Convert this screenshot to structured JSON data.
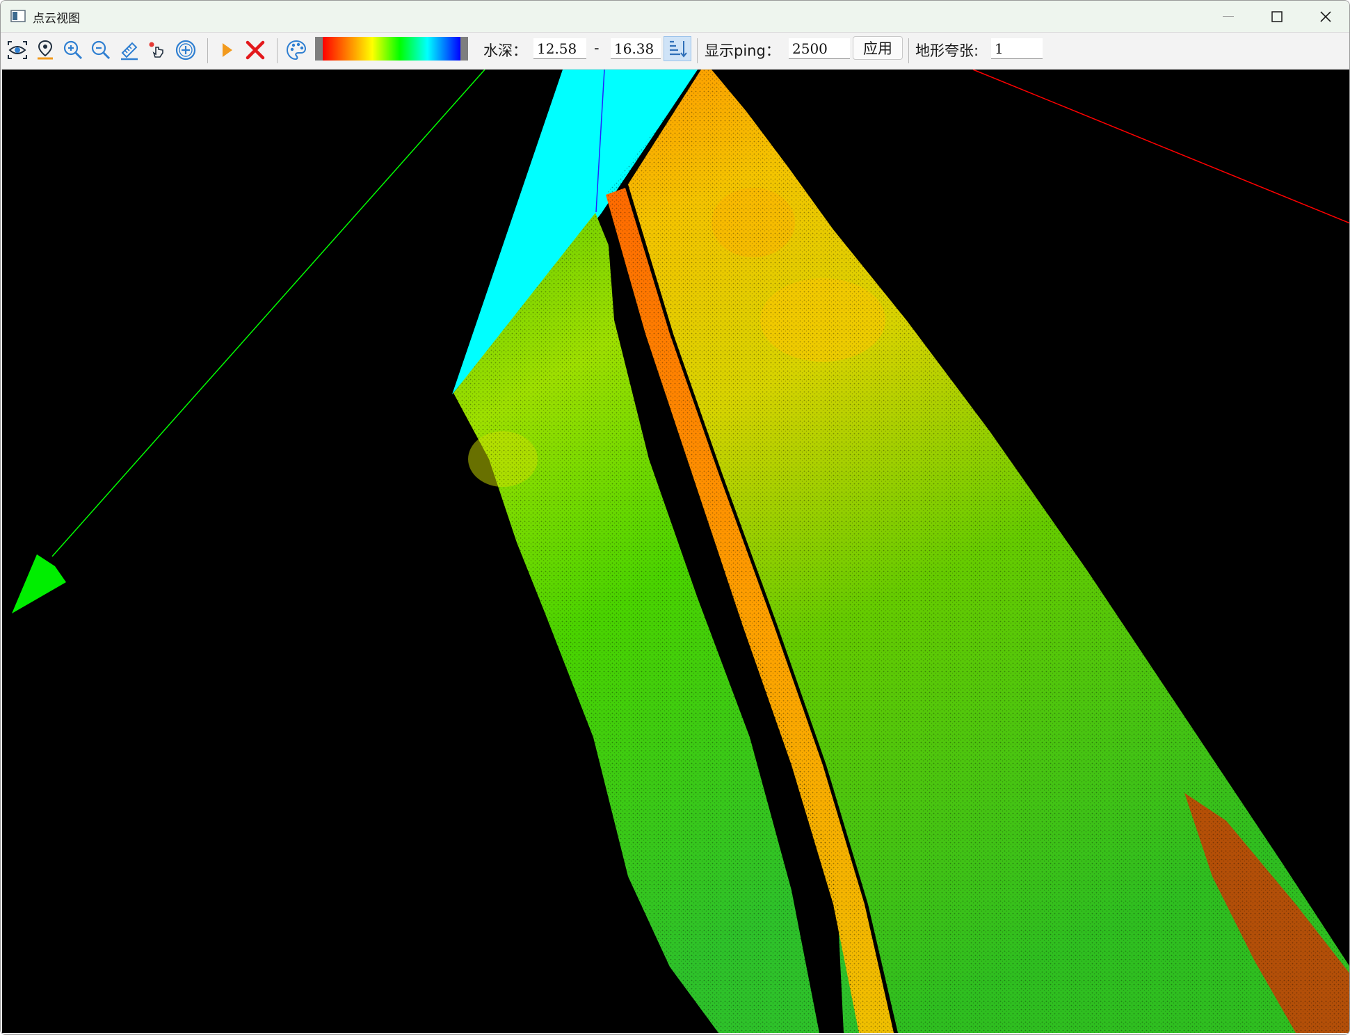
{
  "window": {
    "title": "点云视图"
  },
  "toolbar": {
    "tools": [
      {
        "name": "view-icon"
      },
      {
        "name": "locate-icon"
      },
      {
        "name": "zoom-in-icon"
      },
      {
        "name": "zoom-out-icon"
      },
      {
        "name": "measure-icon"
      },
      {
        "name": "pick-point-icon"
      },
      {
        "name": "add-icon"
      },
      {
        "name": "play-icon"
      },
      {
        "name": "delete-icon"
      },
      {
        "name": "palette-icon"
      }
    ],
    "colorbar_colors": [
      "#ff0000",
      "#ff8000",
      "#ffff00",
      "#00ff00",
      "#00ffff",
      "#0000ff"
    ],
    "depth_label": "水深：",
    "depth_min": "12.58",
    "depth_separator": "-",
    "depth_max": "16.38",
    "ping_label": "显示ping：",
    "ping_value": "2500",
    "apply_label": "应用",
    "exaggeration_label": "地形夸张:",
    "exaggeration_value": "1"
  },
  "viewport": {
    "background": "#000000",
    "axis_colors": {
      "x": "#ff0000",
      "y": "#00ff00",
      "z": "#0000ff"
    },
    "plane_color": "#00ffff"
  }
}
